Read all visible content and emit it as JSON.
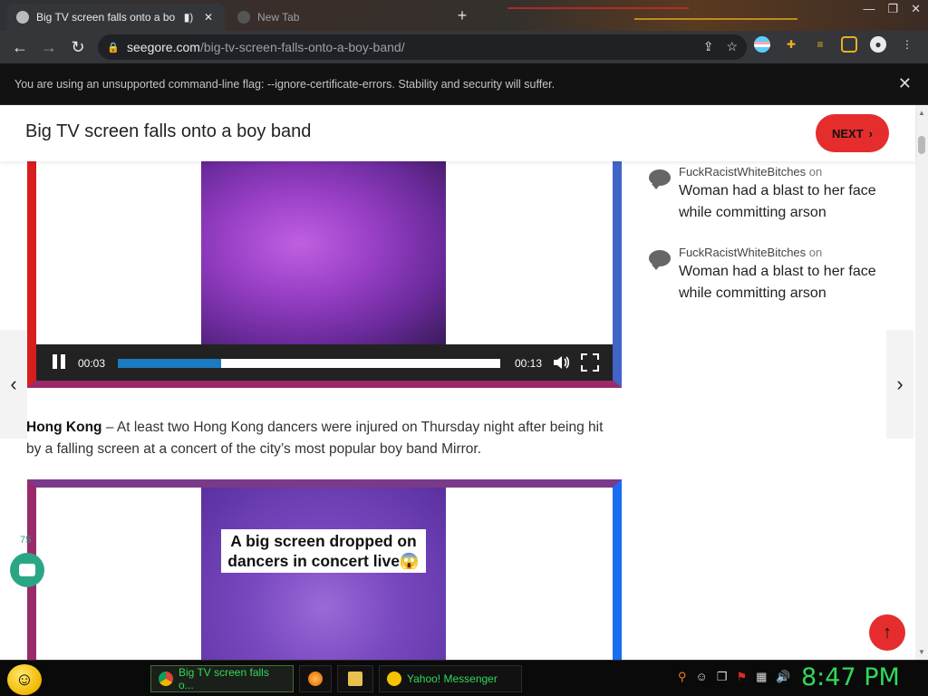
{
  "browser": {
    "tabs": [
      {
        "label": "Big TV screen falls onto a bo",
        "active": true
      },
      {
        "label": "New Tab",
        "active": false
      }
    ],
    "new_tab_symbol": "+",
    "url_host": "seegore.com",
    "url_path": "/big-tv-screen-falls-onto-a-boy-band/",
    "infobar_text": "You are using an unsupported command-line flag: --ignore-certificate-errors. Stability and security will suffer.",
    "infobar_close": "✕"
  },
  "page": {
    "title": "Big TV screen falls onto a boy band",
    "next_label": "NEXT",
    "video1": {
      "current_time": "00:03",
      "duration": "00:13",
      "progress": 0.27
    },
    "article": {
      "location": "Hong Kong",
      "text": " – At least two Hong Kong dancers were injured on Thursday night after being hit by a falling screen at a concert of the city’s most popular boy band Mirror."
    },
    "video2": {
      "caption": "A big screen dropped on dancers in concert live😱"
    },
    "sidebar": {
      "comments": [
        {
          "user": "FuckRacistWhiteBitches",
          "on": "on",
          "post": "Woman had a blast to her face while committing arson"
        },
        {
          "user": "FuckRacistWhiteBitches",
          "on": "on",
          "post": "Woman had a blast to her face while committing arson"
        }
      ]
    },
    "chat_count": "75"
  },
  "taskbar": {
    "items": [
      {
        "label": "Big TV screen falls o..."
      },
      {
        "label": "Yahoo! Messenger"
      }
    ],
    "clock": "8:47 PM"
  },
  "colors": {
    "accent_red": "#e52d2d",
    "progress_blue": "#1c7ac0",
    "taskbar_green": "#31d85a"
  }
}
